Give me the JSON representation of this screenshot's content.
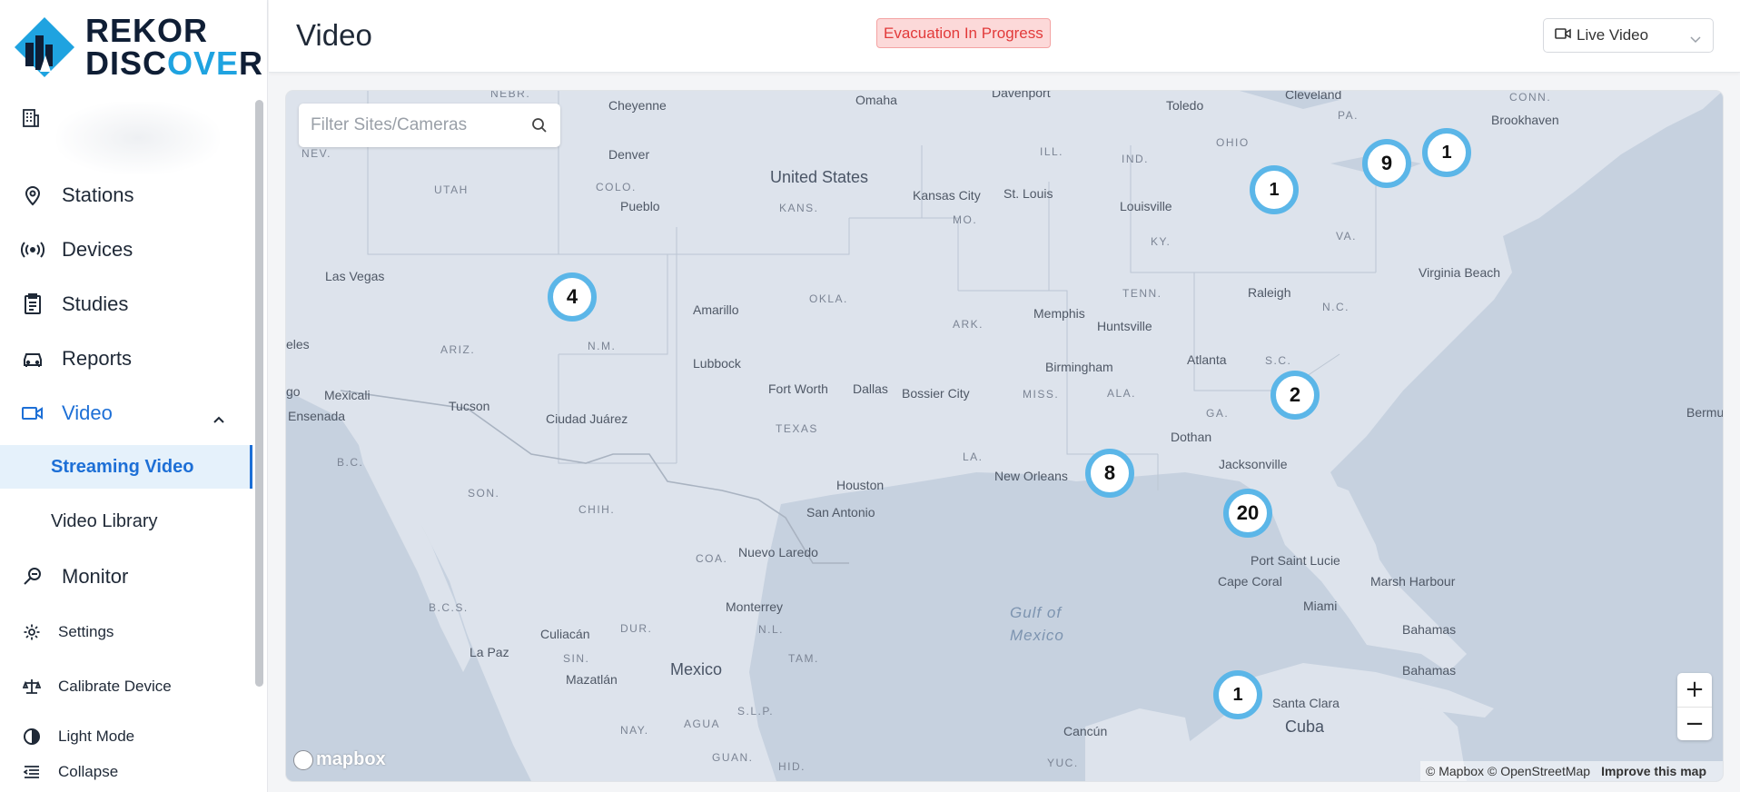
{
  "brand": {
    "line1": "REKOR",
    "line2_pre": "DISC",
    "line2_hl": "OVE",
    "line2_post": "R"
  },
  "sidebar": {
    "workspace_icon": "building-icon",
    "items": [
      {
        "label": "Stations",
        "icon": "map-pin-icon"
      },
      {
        "label": "Devices",
        "icon": "broadcast-icon"
      },
      {
        "label": "Studies",
        "icon": "clipboard-icon"
      },
      {
        "label": "Reports",
        "icon": "car-icon"
      },
      {
        "label": "Video",
        "icon": "video-camera-icon",
        "expanded": true
      },
      {
        "label": "Monitor",
        "icon": "magnify-monitor-icon"
      }
    ],
    "video_sub": [
      {
        "label": "Streaming Video",
        "active": true
      },
      {
        "label": "Video Library",
        "active": false
      }
    ],
    "bottom": [
      {
        "label": "Settings",
        "icon": "gear-icon"
      },
      {
        "label": "Calibrate Device",
        "icon": "scale-icon"
      },
      {
        "label": "Light Mode",
        "icon": "half-circle-icon"
      },
      {
        "label": "Collapse",
        "icon": "collapse-icon"
      }
    ]
  },
  "header": {
    "title": "Video",
    "alert": "Evacuation In Progress",
    "view_select": "Live Video"
  },
  "map": {
    "search_placeholder": "Filter Sites/Cameras",
    "clusters": [
      "1",
      "9",
      "1",
      "4",
      "2",
      "8",
      "20",
      "1"
    ],
    "labels": {
      "united_states": "United States",
      "mexico": "Mexico",
      "cuba": "Cuba",
      "gulf": [
        "Gulf of",
        "Mexico"
      ],
      "states": [
        "NEV.",
        "UTAH",
        "COLO.",
        "KANS.",
        "MO.",
        "ILL.",
        "IND.",
        "OHIO",
        "PA.",
        "CONN.",
        "KY.",
        "VA.",
        "TENN.",
        "N.C.",
        "ARK.",
        "OKLA.",
        "ARIZ.",
        "N.M.",
        "TEXAS",
        "MISS.",
        "ALA.",
        "GA.",
        "S.C.",
        "LA.",
        "B.C.",
        "SON.",
        "CHIH.",
        "COA.",
        "B.C.S.",
        "DUR.",
        "N.L.",
        "TAM.",
        "SIN.",
        "S.L.P.",
        "NAY.",
        "AGUA",
        "GUAN.",
        "HID.",
        "YUC.",
        "NEBR."
      ],
      "cities": [
        "Cheyenne",
        "Omaha",
        "Davenport",
        "Toledo",
        "Cleveland",
        "Brookhaven",
        "Denver",
        "Pueblo",
        "Kansas City",
        "St. Louis",
        "Louisville",
        "Las Vegas",
        "Amarillo",
        "Memphis",
        "Huntsville",
        "Raleigh",
        "Virginia Beach",
        "Lubbock",
        "Birmingham",
        "Atlanta",
        "Fort Worth",
        "Dallas",
        "Bossier City",
        "Tucson",
        "Ciudad Juárez",
        "Mexicali",
        "Ensenada",
        "eles",
        "go",
        "Houston",
        "New Orleans",
        "Dothan",
        "Jacksonville",
        "San Antonio",
        "Nuevo Laredo",
        "Port Saint Lucie",
        "Cape Coral",
        "Miami",
        "Marsh Harbour",
        "Bahamas",
        "Bahamas",
        "Monterrey",
        "Culiacán",
        "La Paz",
        "Mazatlán",
        "Santa Clara",
        "Cancún",
        "Bermu"
      ]
    },
    "zoom_in": "+",
    "zoom_out": "−",
    "mapbox": "mapbox",
    "attribution": [
      "© Mapbox",
      "© OpenStreetMap"
    ],
    "improve": "Improve this map"
  }
}
